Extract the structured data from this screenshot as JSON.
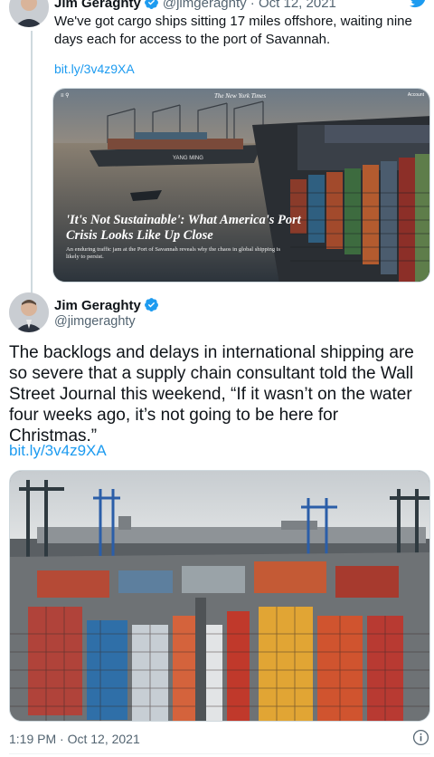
{
  "quoted_tweet": {
    "author_name": "Jim Geraghty",
    "author_handle": "@jimgeraghty",
    "date": "Oct 12, 2021",
    "text": "We've got cargo ships sitting 17 miles offshore, waiting nine days each for access to the port of Savannah.",
    "link": "bit.ly/3v4z9XA",
    "card": {
      "publication": "The New York Times",
      "account_label": "Account",
      "headline": "'It's Not Sustainable': What America's Port Crisis Looks Like Up Close",
      "summary": "An enduring traffic jam at the Port of Savannah reveals why the chaos in global shipping is likely to persist.",
      "ship_name": "YANG MING"
    }
  },
  "main_tweet": {
    "author_name": "Jim Geraghty",
    "author_handle": "@jimgeraghty",
    "text": "The backlogs and delays in international shipping are so severe that a supply chain consultant told the Wall Street Journal this weekend, “If it wasn’t on the water four weeks ago, it’s not going to be here for Christmas.”",
    "link": "bit.ly/3v4z9XA",
    "timestamp": "1:19 PM · Oct 12, 2021"
  },
  "icons": {
    "verified": "verified-badge-icon",
    "brand": "twitter-bird-icon",
    "info": "info-icon"
  },
  "colors": {
    "link": "#1d9bf0",
    "verified": "#1d9bf0",
    "secondary_text": "#536471",
    "border": "#cfd9de"
  }
}
